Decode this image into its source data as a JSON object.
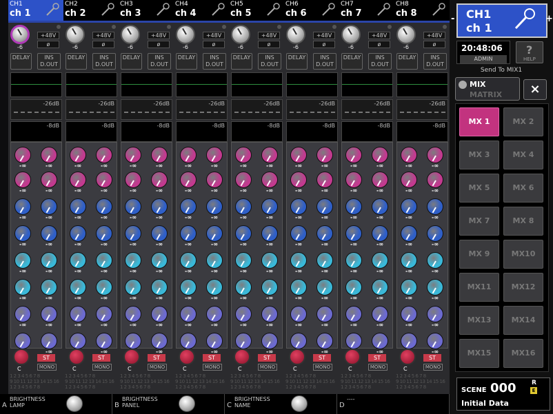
{
  "colors": {
    "selected_channel": "#2d52c8",
    "send_magenta": "#c23a8f",
    "send_blue": "#2f5fc8",
    "send_cyan": "#3ab8d8",
    "send_violet": "#6c6ad0",
    "selected_matrix": "#c2337f"
  },
  "channels": [
    {
      "id": "CH1",
      "name": "ch 1",
      "gain": "-6",
      "selected": true
    },
    {
      "id": "CH2",
      "name": "ch 2",
      "gain": "-6",
      "selected": false
    },
    {
      "id": "CH3",
      "name": "ch 3",
      "gain": "-6",
      "selected": false
    },
    {
      "id": "CH4",
      "name": "ch 4",
      "gain": "-6",
      "selected": false
    },
    {
      "id": "CH5",
      "name": "ch 5",
      "gain": "-6",
      "selected": false
    },
    {
      "id": "CH6",
      "name": "ch 6",
      "gain": "-6",
      "selected": false
    },
    {
      "id": "CH7",
      "name": "ch 7",
      "gain": "-6",
      "selected": false
    },
    {
      "id": "CH8",
      "name": "ch 8",
      "gain": "-6",
      "selected": false
    }
  ],
  "strip_labels": {
    "phantom": "+48V",
    "phase": "ø",
    "delay": "DELAY",
    "ins": "INS",
    "dout": "D.OUT",
    "gate_threshold": "-26dB",
    "comp_threshold": "-8dB",
    "send_value": "-∞",
    "pan": "C",
    "st": "ST",
    "mono": "MONO",
    "assign_row1": "1 2 3 4 5 6 7 8",
    "assign_row2": "9 10 11 12 13 14 15 16",
    "assign_row3": "1 2 3 4 5 6 7 8"
  },
  "selected_channel": {
    "id": "CH1",
    "name": "ch 1"
  },
  "nav": {
    "prev": "-",
    "next": "+"
  },
  "status": {
    "time": "20:48:06",
    "user": "ADMIN"
  },
  "help": {
    "label": "HELP",
    "glyph": "?"
  },
  "send_to": "Send To MIX1",
  "mix_matrix": {
    "mix": "MIX",
    "matrix": "MATRIX"
  },
  "close": "×",
  "matrix_buttons": [
    "MX 1",
    "MX 2",
    "MX 3",
    "MX 4",
    "MX 5",
    "MX 6",
    "MX 7",
    "MX 8",
    "MX 9",
    "MX10",
    "MX11",
    "MX12",
    "MX13",
    "MX14",
    "MX15",
    "MX16"
  ],
  "selected_matrix": "MX 1",
  "scene": {
    "label": "SCENE",
    "number": "000",
    "r": "R",
    "e": "E",
    "name": "Initial Data"
  },
  "bottom_slots": [
    {
      "key": "A",
      "line1": "BRIGHTNESS",
      "line2": "LAMP",
      "knob": true
    },
    {
      "key": "B",
      "line1": "BRIGHTNESS",
      "line2": "PANEL",
      "knob": true
    },
    {
      "key": "C",
      "line1": "BRIGHTNESS",
      "line2": "NAME",
      "knob": true
    },
    {
      "key": "D",
      "line1": "----",
      "line2": "",
      "knob": false
    }
  ]
}
